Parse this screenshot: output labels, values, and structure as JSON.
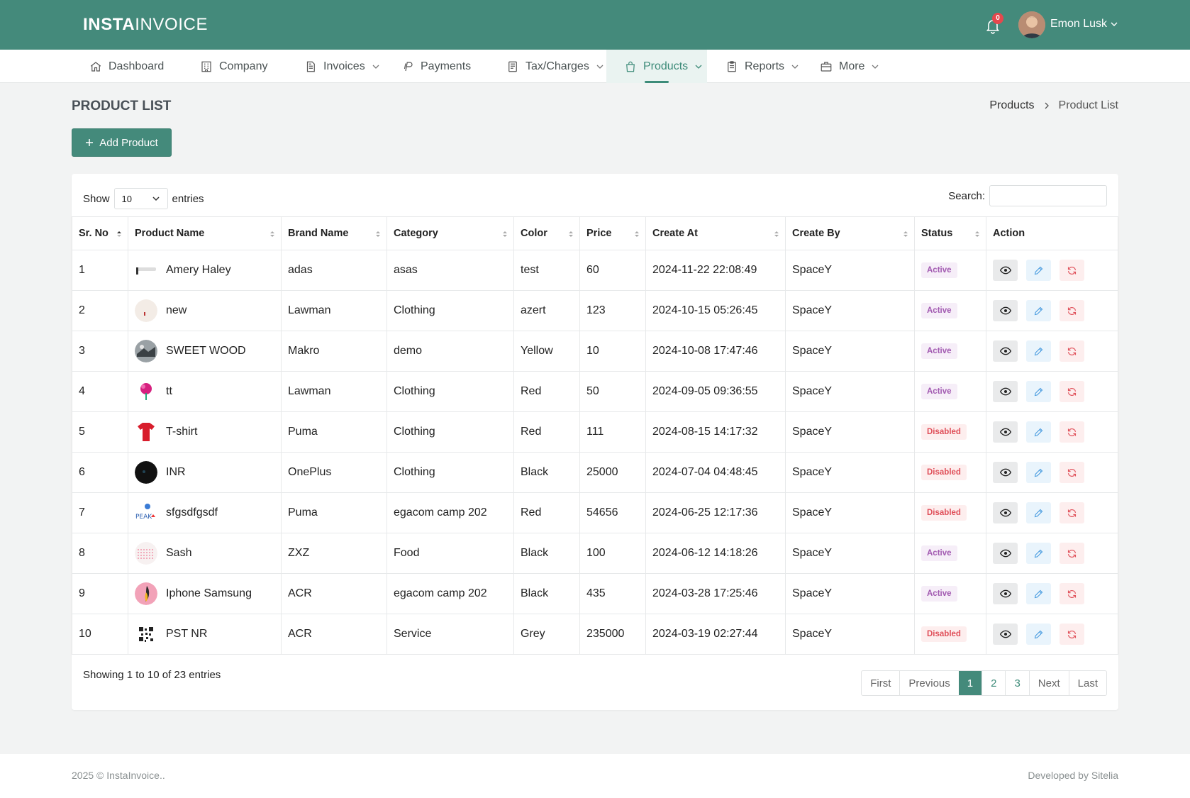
{
  "header": {
    "brand_bold": "INSTA",
    "brand_rest": "INVOICE",
    "notification_count": "0",
    "user_name": "Emon Lusk"
  },
  "nav": [
    {
      "label": "Dashboard",
      "icon": "home-icon"
    },
    {
      "label": "Company",
      "icon": "building-icon"
    },
    {
      "label": "Invoices",
      "icon": "invoice-icon",
      "dropdown": true
    },
    {
      "label": "Payments",
      "icon": "payments-icon"
    },
    {
      "label": "Tax/Charges",
      "icon": "receipt-icon",
      "dropdown": true
    },
    {
      "label": "Products",
      "icon": "shopping-bag-icon",
      "dropdown": true,
      "active": true
    },
    {
      "label": "Reports",
      "icon": "clipboard-icon",
      "dropdown": true
    },
    {
      "label": "More",
      "icon": "briefcase-icon",
      "dropdown": true
    }
  ],
  "page": {
    "title": "PRODUCT LIST",
    "breadcrumb_parent": "Products",
    "breadcrumb_current": "Product List",
    "add_button": "Add Product"
  },
  "table_controls": {
    "show_label": "Show",
    "entries_value": "10",
    "entries_label": "entries",
    "search_label": "Search:",
    "search_value": ""
  },
  "columns": [
    "Sr. No",
    "Product Name",
    "Brand Name",
    "Category",
    "Color",
    "Price",
    "Create At",
    "Create By",
    "Status",
    "Action"
  ],
  "rows": [
    {
      "sr": "1",
      "name": "Amery Haley",
      "brand": "adas",
      "category": "asas",
      "color": "test",
      "price": "60",
      "created": "2024-11-22 22:08:49",
      "by": "SpaceY",
      "status": "Active"
    },
    {
      "sr": "2",
      "name": "new",
      "brand": "Lawman",
      "category": "Clothing",
      "color": "azert",
      "price": "123",
      "created": "2024-10-15 05:26:45",
      "by": "SpaceY",
      "status": "Active"
    },
    {
      "sr": "3",
      "name": "SWEET WOOD",
      "brand": "Makro",
      "category": "demo",
      "color": "Yellow",
      "price": "10",
      "created": "2024-10-08 17:47:46",
      "by": "SpaceY",
      "status": "Active"
    },
    {
      "sr": "4",
      "name": "tt",
      "brand": "Lawman",
      "category": "Clothing",
      "color": "Red",
      "price": "50",
      "created": "2024-09-05 09:36:55",
      "by": "SpaceY",
      "status": "Active"
    },
    {
      "sr": "5",
      "name": "T-shirt",
      "brand": "Puma",
      "category": "Clothing",
      "color": "Red",
      "price": "111",
      "created": "2024-08-15 14:17:32",
      "by": "SpaceY",
      "status": "Disabled"
    },
    {
      "sr": "6",
      "name": "INR",
      "brand": "OnePlus",
      "category": "Clothing",
      "color": "Black",
      "price": "25000",
      "created": "2024-07-04 04:48:45",
      "by": "SpaceY",
      "status": "Disabled"
    },
    {
      "sr": "7",
      "name": "sfgsdfgsdf",
      "brand": "Puma",
      "category": "egacom camp 202",
      "color": "Red",
      "price": "54656",
      "created": "2024-06-25 12:17:36",
      "by": "SpaceY",
      "status": "Disabled"
    },
    {
      "sr": "8",
      "name": "Sash",
      "brand": "ZXZ",
      "category": "Food",
      "color": "Black",
      "price": "100",
      "created": "2024-06-12 14:18:26",
      "by": "SpaceY",
      "status": "Active"
    },
    {
      "sr": "9",
      "name": "Iphone Samsung",
      "brand": "ACR",
      "category": "egacom camp 202",
      "color": "Black",
      "price": "435",
      "created": "2024-03-28 17:25:46",
      "by": "SpaceY",
      "status": "Active"
    },
    {
      "sr": "10",
      "name": "PST NR",
      "brand": "ACR",
      "category": "Service",
      "color": "Grey",
      "price": "235000",
      "created": "2024-03-19 02:27:44",
      "by": "SpaceY",
      "status": "Disabled"
    }
  ],
  "footer_info": {
    "showing": "Showing 1 to 10 of 23 entries"
  },
  "pagination": {
    "first": "First",
    "previous": "Previous",
    "pages": [
      "1",
      "2",
      "3"
    ],
    "current": "1",
    "next": "Next",
    "last": "Last"
  },
  "footer": {
    "copyright": "2025 © InstaInvoice..",
    "developed": "Developed by Sitelia"
  },
  "colors": {
    "primary": "#448a7b",
    "active_badge": "#a25ab1",
    "disabled_badge": "#e0505a"
  }
}
